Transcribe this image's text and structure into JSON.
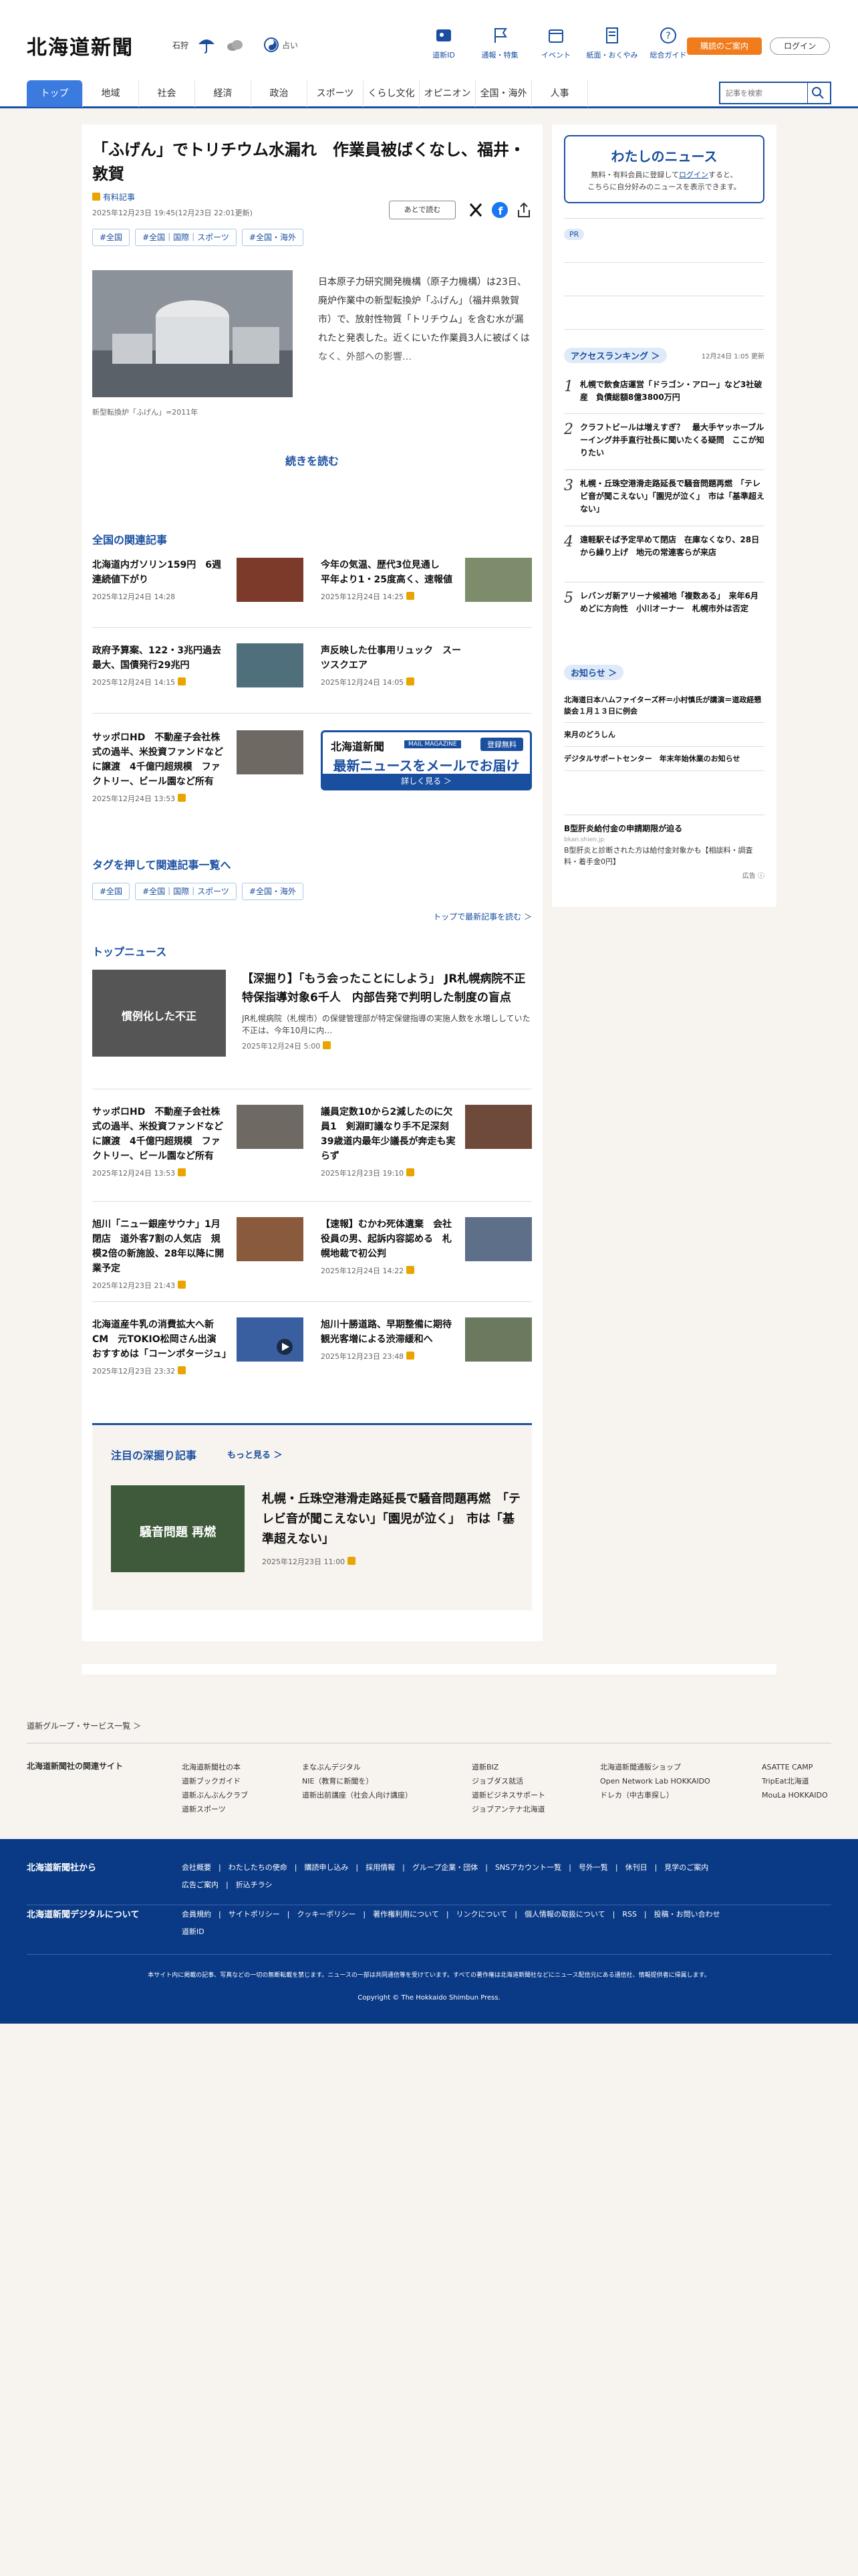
{
  "header": {
    "logo": "北海道新聞",
    "city": "石狩",
    "weather_rank": "占い",
    "nav": [
      "道新ID",
      "通報・特集",
      "イベント",
      "紙面・おくやみ",
      "総合ガイド"
    ],
    "guide_button": "購読のご案内",
    "login_button": "ログイン"
  },
  "categories": [
    "トップ",
    "地域",
    "社会",
    "経済",
    "政治",
    "スポーツ",
    "くらし文化",
    "オピニオン",
    "全国・海外",
    "人事"
  ],
  "search": {
    "placeholder": "記事を検索"
  },
  "article": {
    "title": "「ふげん」でトリチウム水漏れ　作業員被ばくなし、福井・敦賀",
    "badge": "有料記事",
    "date": "2025年12月23日 19:45(12月23日 22:01更新)",
    "save_later": "あとで読む",
    "tags": [
      "#全国",
      "#全国｜国際｜スポーツ",
      "#全国・海外"
    ],
    "caption": "新型転換炉「ふげん」=2011年",
    "lead": "日本原子力研究開発機構（原子力機構）は23日、廃炉作業中の新型転換炉「ふげん」（福井県敦賀市）で、放射性物質「トリチウム」を含む水が漏れたと発表した。近くにいた作業員3人に被ばくはなく、外部への影響…",
    "read_more": "続きを読む"
  },
  "related": {
    "heading": "全国の関連記事",
    "items": [
      {
        "title": "北海道内ガソリン159円　6週連続値下がり",
        "date": "2025年12月24日 14:28"
      },
      {
        "title": "今年の気温、歴代3位見通し　平年より1・25度高く、速報値",
        "date": "2025年12月24日 14:25"
      },
      {
        "title": "政府予算案、122・3兆円過去最大、国債発行29兆円",
        "date": "2025年12月24日 14:15"
      },
      {
        "title": "声反映した仕事用リュック　スーツスクエア",
        "date": "2025年12月24日 14:05"
      },
      {
        "title": "サッポロHD　不動産子会社株式の過半、米投資ファンドなどに譲渡　4千億円超規模　ファクトリー、ビール園など所有",
        "date": "2025年12月24日 13:53"
      }
    ]
  },
  "mail_promo": {
    "logo": "北海道新聞",
    "tag": "MAIL MAGAZINE",
    "free": "登録無料",
    "headline": "最新ニュースをメールでお届け",
    "button": "詳しく見る ＞"
  },
  "tag_section": {
    "heading": "タグを押して関連記事一覧へ",
    "tags": [
      "#全国",
      "#全国｜国際｜スポーツ",
      "#全国・海外"
    ],
    "more": "トップで最新記事を読む ＞"
  },
  "top_news": {
    "heading": "トップニュース",
    "lead": {
      "title": "【深掘り】「もう会ったことにしよう」 JR札幌病院不正　特保指導対象6千人　内部告発で判明した制度の盲点",
      "summary": "JR札幌病院（札幌市）の保健管理部が特定保健指導の実施人数を水増ししていた不正は、今年10月に内…",
      "date": "2025年12月24日 5:00",
      "image_text": "慣例化した不正"
    },
    "items": [
      {
        "title": "サッポロHD　不動産子会社株式の過半、米投資ファンドなどに譲渡　4千億円超規模　ファクトリー、ビール園など所有",
        "date": "2025年12月24日 13:53"
      },
      {
        "title": "議員定数10から2減したのに欠員1　剣淵町議なり手不足深刻　39歳道内最年少議長が奔走も実らず",
        "date": "2025年12月23日 19:10"
      },
      {
        "title": "旭川「ニュー銀座サウナ」1月閉店　道外客7割の人気店　規模2倍の新施設、28年以降に開業予定",
        "date": "2025年12月23日 21:43"
      },
      {
        "title": "【速報】むかわ死体遺棄　会社役員の男、起訴内容認める　札幌地裁で初公判",
        "date": "2025年12月24日 14:22"
      },
      {
        "title": "北海道産牛乳の消費拡大へ新CM　元TOKIO松岡さん出演　おすすめは「コーンポタージュ」",
        "date": "2025年12月23日 23:32"
      },
      {
        "title": "旭川十勝道路、早期整備に期待　観光客増による渋滞緩和へ",
        "date": "2025年12月23日 23:48"
      }
    ]
  },
  "feature": {
    "heading": "注目の深掘り記事",
    "more": "もっと見る ＞",
    "title": "札幌・丘珠空港滑走路延長で騒音問題再燃　「テレビ音が聞こえない」「園児が泣く」　市は「基準超えない」",
    "date": "2025年12月23日 11:00",
    "image_text": "騒音問題 再燃"
  },
  "sidebar": {
    "my_news": {
      "title": "わたしのニュース",
      "text1": "無料・有料会員に登録して",
      "login": "ログイン",
      "text2": "すると、",
      "text3": "こちらに自分好みのニュースを表示できます。"
    },
    "pr": "PR",
    "ranking": {
      "heading": "アクセスランキング ＞",
      "updated": "12月24日 1:05 更新",
      "items": [
        "札幌で飲食店運営「ドラゴン・アロー」など3社破産　負債総額8億3800万円",
        "クラフトビールは増えすぎ？　最大手ヤッホーブルーイング井手直行社長に聞いたくる疑問　ここが知りたい",
        "札幌・丘珠空港滑走路延長で騒音問題再燃　「テレビ音が聞こえない」「園児が泣く」　市は「基準超えない」",
        "遠軽駅そば予定早めて閉店　在庫なくなり、28日から繰り上げ　地元の常連客らが来店",
        "レバンガ新アリーナ候補地「複数ある」　来年6月めどに方向性　小川オーナー　札幌市外は否定"
      ]
    },
    "notice": {
      "heading": "お知らせ ＞",
      "items": [
        "北海道日本ハムファイターズ杯＝小村慎氏が講演＝道政経懇談会１月１３日に例会",
        "来月のどうしん",
        "デジタルサポートセンター　年末年始休業のお知らせ"
      ]
    },
    "ad": {
      "title": "B型肝炎給付金の申請期限が迫る",
      "source": "bkan.shien.jp",
      "text": "B型肝炎と診断された方は給付金対象かも【相談料・調査料・着手金0円】",
      "label": "広告"
    }
  },
  "footer": {
    "group_heading": "道新グループ・サービス一覧 ＞",
    "related_heading": "北海道新聞社の関連サイト",
    "related": [
      [
        "北海道新聞社の本",
        "道新ブックガイド",
        "道新ぶんぶんクラブ",
        "道新スポーツ"
      ],
      [
        "まなぶんデジタル",
        "NIE（教育に新聞を）",
        "道新出前講座（社会人向け講座）"
      ],
      [
        "道新BIZ",
        "ジョブダス就活",
        "道新ビジネスサポート",
        "ジョブアンテナ北海道"
      ],
      [
        "北海道新聞通販ショップ",
        "Open Network Lab HOKKAIDO",
        "ドレカ（中古車探し）"
      ],
      [
        "ASATTE CAMP",
        "TripEat北海道",
        "MouLa HOKKAIDO"
      ]
    ],
    "company_heading": "北海道新聞社から",
    "company_links": [
      "会社概要",
      "わたしたちの使命",
      "購読申し込み",
      "採用情報",
      "グループ企業・団体",
      "SNSアカウント一覧",
      "号外一覧",
      "休刊日",
      "見学のご案内",
      "広告ご案内",
      "折込チラシ"
    ],
    "digital_heading": "北海道新聞デジタルについて",
    "digital_links": [
      "会員規約",
      "サイトポリシー",
      "クッキーポリシー",
      "著作権利用について",
      "リンクについて",
      "個人情報の取扱について",
      "RSS",
      "投稿・お問い合わせ",
      "道新ID"
    ],
    "notice": "本サイト内に掲載の記事、写真などの一切の無断転載を禁じます。ニュースの一部は共同通信等を受けています。すべての著作権は北海道新聞社などにニュース配信元にある通信社、情報提供者に帰属します。",
    "copyright": "Copyright © The Hokkaido Shimbun Press."
  }
}
